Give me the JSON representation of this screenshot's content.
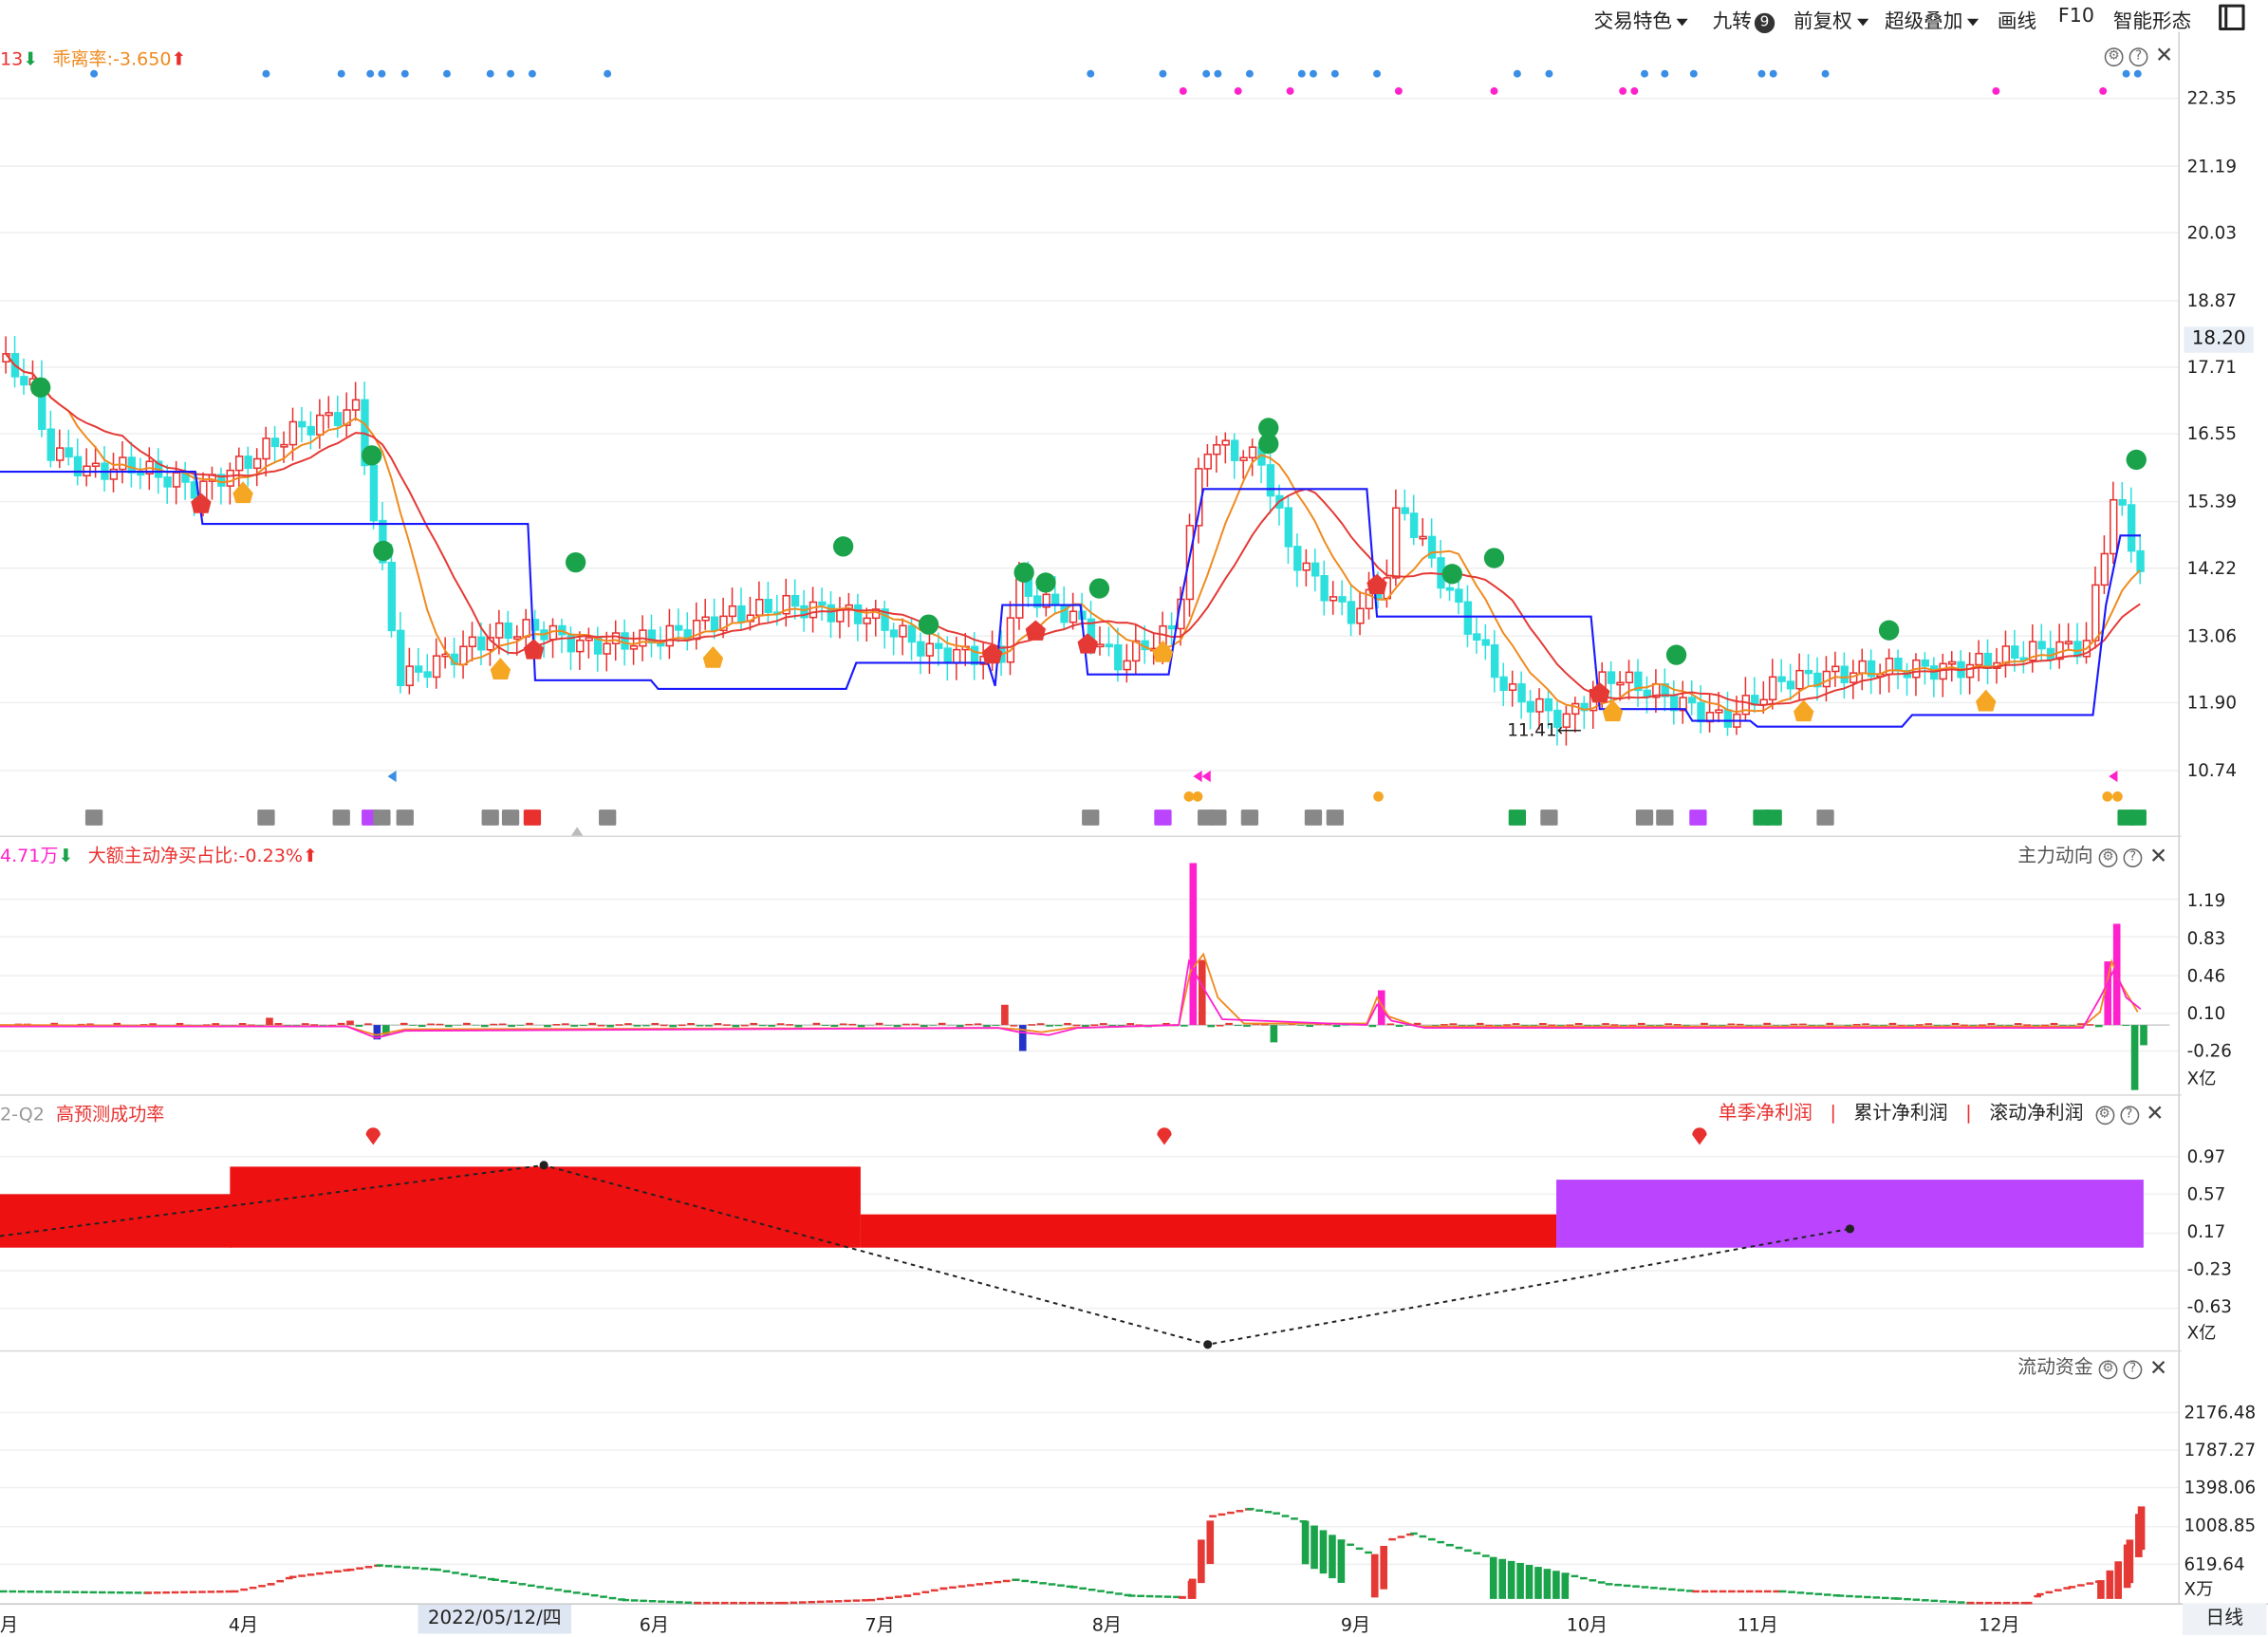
{
  "toolbar": {
    "items": [
      {
        "label": "交易特色",
        "dropdown": true
      },
      {
        "label": "九转",
        "badge": "9"
      },
      {
        "label": "前复权",
        "dropdown": true
      },
      {
        "label": "超级叠加",
        "dropdown": true
      },
      {
        "label": "画线"
      },
      {
        "label": "F10"
      },
      {
        "label": "智能形态"
      }
    ]
  },
  "main_pane": {
    "indicator_prefix": "13",
    "indicator_label": "乖离率:-3.650",
    "current_price": "18.20",
    "low_mark": "11.41",
    "y_ticks": [
      "22.35",
      "21.19",
      "20.03",
      "18.87",
      "17.71",
      "16.55",
      "15.39",
      "14.22",
      "13.06",
      "11.90",
      "10.74"
    ]
  },
  "flow_pane": {
    "value_prefix": "4.71万",
    "ratio_label": "大额主动净买占比:-0.23%",
    "title": "主力动向",
    "y_ticks": [
      "1.19",
      "0.83",
      "0.46",
      "0.10",
      "-0.26"
    ],
    "unit": "X亿"
  },
  "profit_pane": {
    "quarter_prefix": "2-Q2",
    "label": "高预测成功率",
    "tabs": [
      "单季净利润",
      "累计净利润",
      "滚动净利润"
    ],
    "y_ticks": [
      "0.97",
      "0.57",
      "0.17",
      "-0.23",
      "-0.63"
    ],
    "unit": "X亿"
  },
  "float_pane": {
    "title": "流动资金",
    "y_ticks": [
      "2176.48",
      "1787.27",
      "1398.06",
      "1008.85",
      "619.64"
    ],
    "unit": "X万"
  },
  "x_axis": {
    "months": [
      "月",
      "4月",
      "6月",
      "7月",
      "8月",
      "9月",
      "10月",
      "11月",
      "12月"
    ],
    "cursor_date": "2022/05/12/四",
    "period": "日线"
  },
  "colors": {
    "up": "#e8312f",
    "down": "#2de0de",
    "ma_red": "#e53935",
    "ma_orange": "#f08a1e",
    "stop_line": "#1a1aff",
    "magenta": "#ff22cc",
    "bar_red": "#ee1111",
    "bar_purple": "#bb44ff",
    "sell_green": "#1aa34a",
    "buy_orange": "#f5a623"
  }
}
